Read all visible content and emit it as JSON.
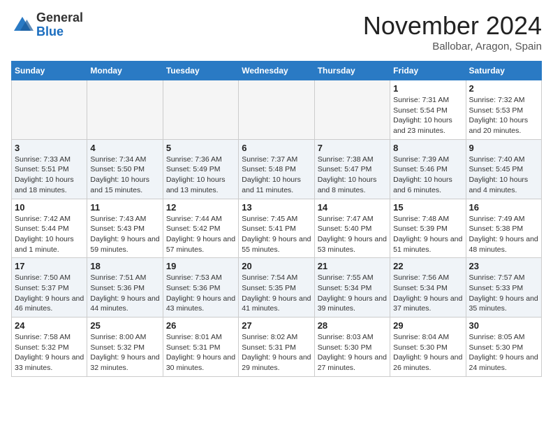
{
  "header": {
    "logo": {
      "general": "General",
      "blue": "Blue"
    },
    "month_title": "November 2024",
    "subtitle": "Ballobar, Aragon, Spain"
  },
  "calendar": {
    "days_of_week": [
      "Sunday",
      "Monday",
      "Tuesday",
      "Wednesday",
      "Thursday",
      "Friday",
      "Saturday"
    ],
    "weeks": [
      [
        {
          "day": "",
          "empty": true
        },
        {
          "day": "",
          "empty": true
        },
        {
          "day": "",
          "empty": true
        },
        {
          "day": "",
          "empty": true
        },
        {
          "day": "",
          "empty": true
        },
        {
          "day": "1",
          "sunrise": "7:31 AM",
          "sunset": "5:54 PM",
          "daylight": "10 hours and 23 minutes."
        },
        {
          "day": "2",
          "sunrise": "7:32 AM",
          "sunset": "5:53 PM",
          "daylight": "10 hours and 20 minutes."
        }
      ],
      [
        {
          "day": "3",
          "sunrise": "7:33 AM",
          "sunset": "5:51 PM",
          "daylight": "10 hours and 18 minutes."
        },
        {
          "day": "4",
          "sunrise": "7:34 AM",
          "sunset": "5:50 PM",
          "daylight": "10 hours and 15 minutes."
        },
        {
          "day": "5",
          "sunrise": "7:36 AM",
          "sunset": "5:49 PM",
          "daylight": "10 hours and 13 minutes."
        },
        {
          "day": "6",
          "sunrise": "7:37 AM",
          "sunset": "5:48 PM",
          "daylight": "10 hours and 11 minutes."
        },
        {
          "day": "7",
          "sunrise": "7:38 AM",
          "sunset": "5:47 PM",
          "daylight": "10 hours and 8 minutes."
        },
        {
          "day": "8",
          "sunrise": "7:39 AM",
          "sunset": "5:46 PM",
          "daylight": "10 hours and 6 minutes."
        },
        {
          "day": "9",
          "sunrise": "7:40 AM",
          "sunset": "5:45 PM",
          "daylight": "10 hours and 4 minutes."
        }
      ],
      [
        {
          "day": "10",
          "sunrise": "7:42 AM",
          "sunset": "5:44 PM",
          "daylight": "10 hours and 1 minute."
        },
        {
          "day": "11",
          "sunrise": "7:43 AM",
          "sunset": "5:43 PM",
          "daylight": "9 hours and 59 minutes."
        },
        {
          "day": "12",
          "sunrise": "7:44 AM",
          "sunset": "5:42 PM",
          "daylight": "9 hours and 57 minutes."
        },
        {
          "day": "13",
          "sunrise": "7:45 AM",
          "sunset": "5:41 PM",
          "daylight": "9 hours and 55 minutes."
        },
        {
          "day": "14",
          "sunrise": "7:47 AM",
          "sunset": "5:40 PM",
          "daylight": "9 hours and 53 minutes."
        },
        {
          "day": "15",
          "sunrise": "7:48 AM",
          "sunset": "5:39 PM",
          "daylight": "9 hours and 51 minutes."
        },
        {
          "day": "16",
          "sunrise": "7:49 AM",
          "sunset": "5:38 PM",
          "daylight": "9 hours and 48 minutes."
        }
      ],
      [
        {
          "day": "17",
          "sunrise": "7:50 AM",
          "sunset": "5:37 PM",
          "daylight": "9 hours and 46 minutes."
        },
        {
          "day": "18",
          "sunrise": "7:51 AM",
          "sunset": "5:36 PM",
          "daylight": "9 hours and 44 minutes."
        },
        {
          "day": "19",
          "sunrise": "7:53 AM",
          "sunset": "5:36 PM",
          "daylight": "9 hours and 43 minutes."
        },
        {
          "day": "20",
          "sunrise": "7:54 AM",
          "sunset": "5:35 PM",
          "daylight": "9 hours and 41 minutes."
        },
        {
          "day": "21",
          "sunrise": "7:55 AM",
          "sunset": "5:34 PM",
          "daylight": "9 hours and 39 minutes."
        },
        {
          "day": "22",
          "sunrise": "7:56 AM",
          "sunset": "5:34 PM",
          "daylight": "9 hours and 37 minutes."
        },
        {
          "day": "23",
          "sunrise": "7:57 AM",
          "sunset": "5:33 PM",
          "daylight": "9 hours and 35 minutes."
        }
      ],
      [
        {
          "day": "24",
          "sunrise": "7:58 AM",
          "sunset": "5:32 PM",
          "daylight": "9 hours and 33 minutes."
        },
        {
          "day": "25",
          "sunrise": "8:00 AM",
          "sunset": "5:32 PM",
          "daylight": "9 hours and 32 minutes."
        },
        {
          "day": "26",
          "sunrise": "8:01 AM",
          "sunset": "5:31 PM",
          "daylight": "9 hours and 30 minutes."
        },
        {
          "day": "27",
          "sunrise": "8:02 AM",
          "sunset": "5:31 PM",
          "daylight": "9 hours and 29 minutes."
        },
        {
          "day": "28",
          "sunrise": "8:03 AM",
          "sunset": "5:30 PM",
          "daylight": "9 hours and 27 minutes."
        },
        {
          "day": "29",
          "sunrise": "8:04 AM",
          "sunset": "5:30 PM",
          "daylight": "9 hours and 26 minutes."
        },
        {
          "day": "30",
          "sunrise": "8:05 AM",
          "sunset": "5:30 PM",
          "daylight": "9 hours and 24 minutes."
        }
      ]
    ]
  }
}
